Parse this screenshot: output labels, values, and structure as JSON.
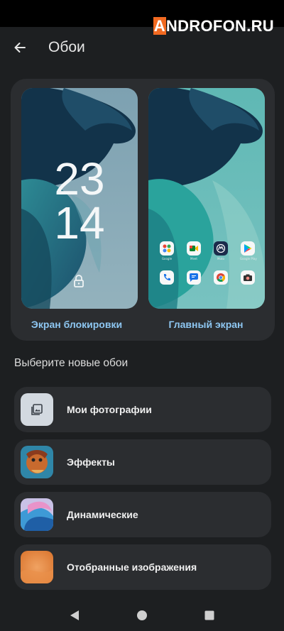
{
  "watermark": {
    "first_letter": "A",
    "rest": "NDROFON.RU"
  },
  "app_bar": {
    "title": "Обои",
    "back_icon": "arrow-left-icon"
  },
  "preview": {
    "lock_screen": {
      "clock_hours": "23",
      "clock_minutes": "14",
      "label": "Экран блокировки",
      "icon": "lock-icon"
    },
    "home_screen": {
      "label": "Главный экран",
      "apps_row1": [
        {
          "icon": "google-folder-icon",
          "name": "Google"
        },
        {
          "icon": "meet-icon",
          "name": "Meet"
        },
        {
          "icon": "moto-icon",
          "name": "Moto"
        },
        {
          "icon": "google-play-icon",
          "name": "Google Play"
        }
      ],
      "apps_row2": [
        {
          "icon": "phone-icon",
          "name": ""
        },
        {
          "icon": "messages-icon",
          "name": ""
        },
        {
          "icon": "chrome-icon",
          "name": ""
        },
        {
          "icon": "camera-icon",
          "name": ""
        }
      ]
    }
  },
  "section_title": "Выберите новые обои",
  "options": [
    {
      "label": "Мои фотографии",
      "icon": "photo-gallery-icon"
    },
    {
      "label": "Эффекты",
      "icon": "effects-thumbnail"
    },
    {
      "label": "Динамические",
      "icon": "dynamic-thumbnail"
    },
    {
      "label": "Отобранные изображения",
      "icon": "curated-thumbnail"
    }
  ],
  "nav": {
    "back": "nav-back-icon",
    "home": "nav-home-icon",
    "recents": "nav-recents-icon"
  },
  "colors": {
    "background": "#1d1f21",
    "card": "#2b2d30",
    "accent_label": "#8ec7f2"
  }
}
